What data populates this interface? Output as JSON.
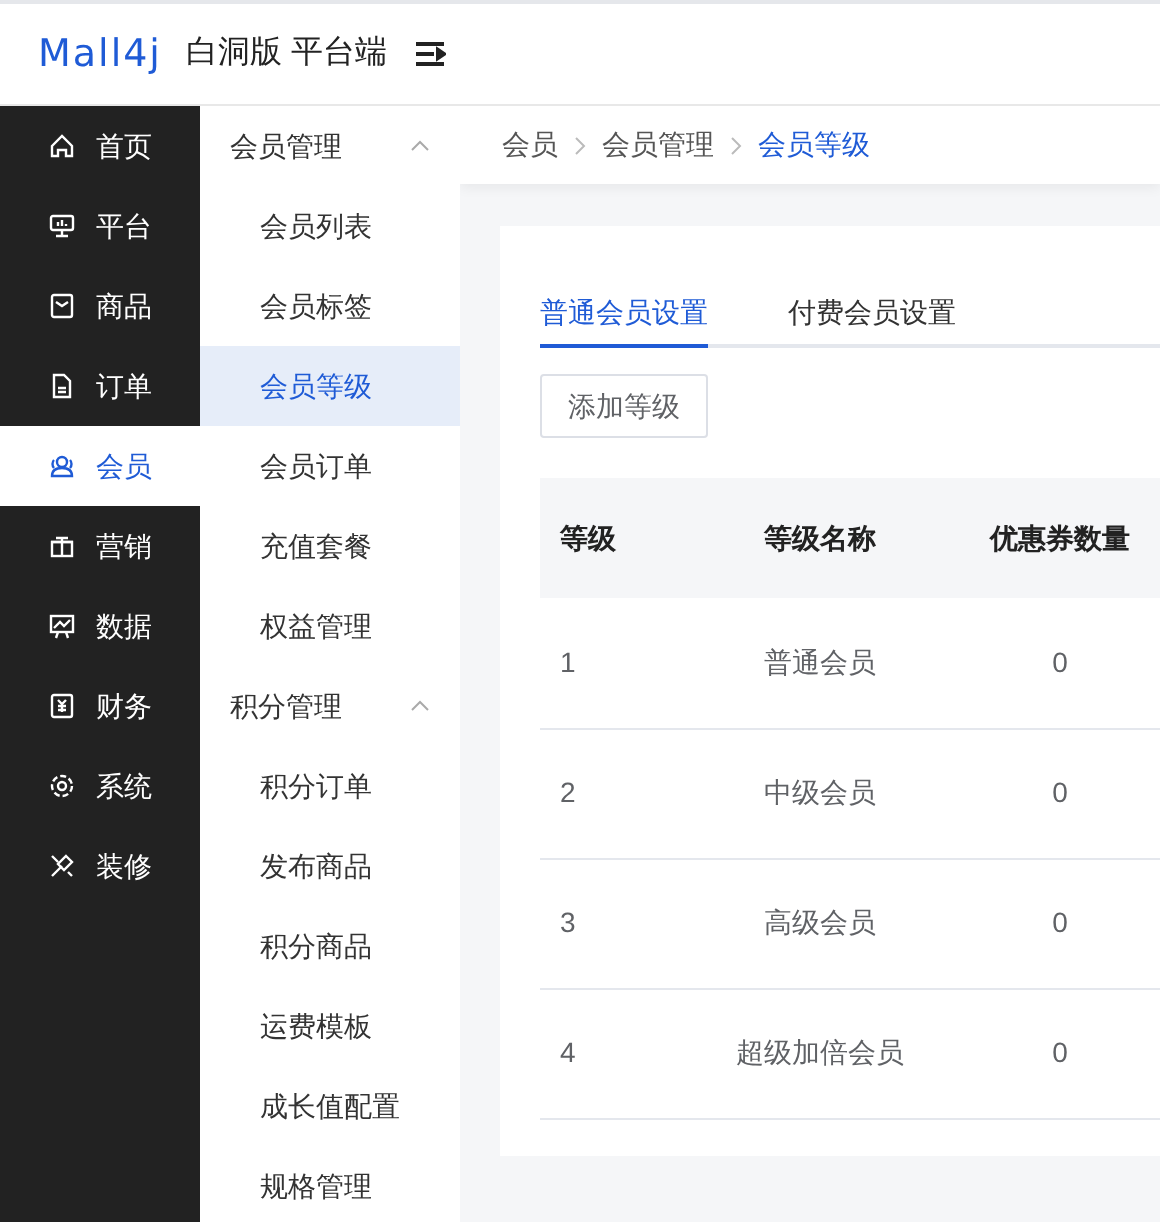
{
  "header": {
    "logo": "Mall4j",
    "title": "白洞版 平台端"
  },
  "sidebar": {
    "items": [
      {
        "label": "首页",
        "selected": false
      },
      {
        "label": "平台",
        "selected": false
      },
      {
        "label": "商品",
        "selected": false
      },
      {
        "label": "订单",
        "selected": false
      },
      {
        "label": "会员",
        "selected": true
      },
      {
        "label": "营销",
        "selected": false
      },
      {
        "label": "数据",
        "selected": false
      },
      {
        "label": "财务",
        "selected": false
      },
      {
        "label": "系统",
        "selected": false
      },
      {
        "label": "装修",
        "selected": false
      }
    ]
  },
  "submenu": [
    {
      "label": "会员管理",
      "expanded": true,
      "children": [
        {
          "label": "会员列表",
          "selected": false
        },
        {
          "label": "会员标签",
          "selected": false
        },
        {
          "label": "会员等级",
          "selected": true
        },
        {
          "label": "会员订单",
          "selected": false
        },
        {
          "label": "充值套餐",
          "selected": false
        },
        {
          "label": "权益管理",
          "selected": false
        }
      ]
    },
    {
      "label": "积分管理",
      "expanded": true,
      "children": [
        {
          "label": "积分订单",
          "selected": false
        },
        {
          "label": "发布商品",
          "selected": false
        },
        {
          "label": "积分商品",
          "selected": false
        },
        {
          "label": "运费模板",
          "selected": false
        },
        {
          "label": "成长值配置",
          "selected": false
        },
        {
          "label": "规格管理",
          "selected": false
        }
      ]
    }
  ],
  "breadcrumb": [
    "会员",
    "会员管理",
    "会员等级"
  ],
  "tabs": [
    {
      "label": "普通会员设置",
      "selected": true
    },
    {
      "label": "付费会员设置",
      "selected": false
    }
  ],
  "add_button": "添加等级",
  "table": {
    "columns": [
      "等级",
      "等级名称",
      "优惠券数量"
    ],
    "rows": [
      [
        "1",
        "普通会员",
        "0"
      ],
      [
        "2",
        "中级会员",
        "0"
      ],
      [
        "3",
        "高级会员",
        "0"
      ],
      [
        "4",
        "超级加倍会员",
        "0"
      ]
    ]
  }
}
